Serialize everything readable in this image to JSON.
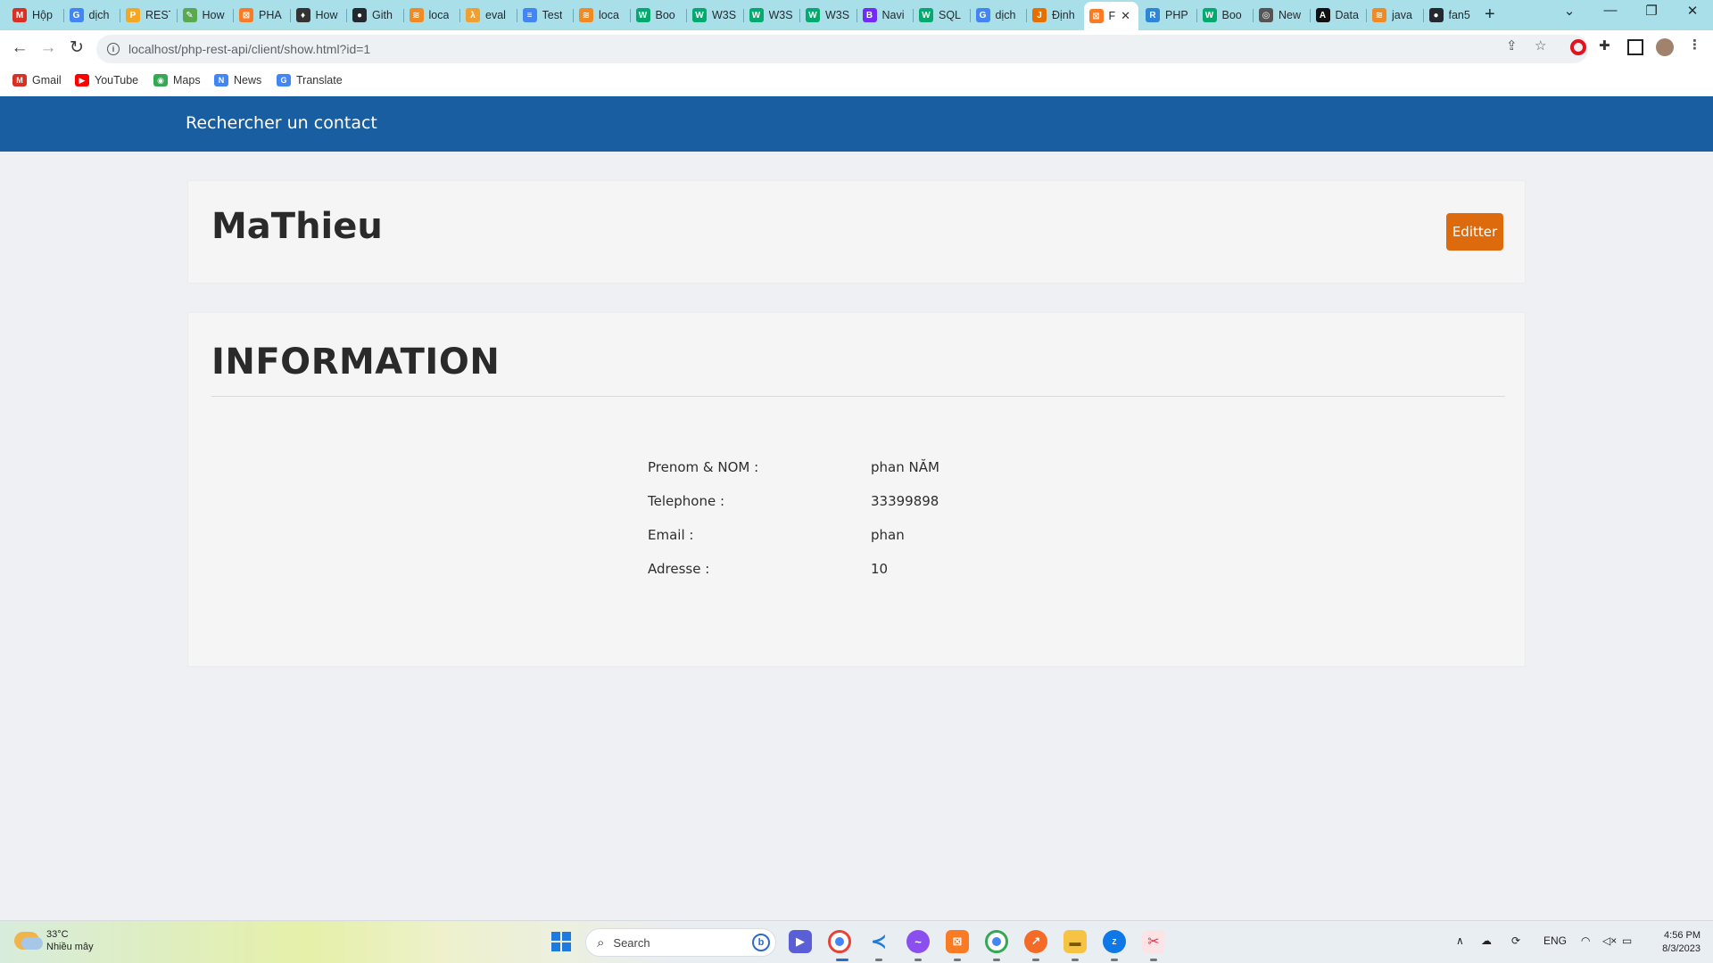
{
  "browser": {
    "tabs": [
      {
        "label": "Hộp",
        "icon": "gmail-icon",
        "color": "#d93025",
        "glyph": "M"
      },
      {
        "label": "dịch",
        "icon": "google-icon",
        "color": "#4285f4",
        "glyph": "G"
      },
      {
        "label": "REST",
        "icon": "postman-icon",
        "color": "#f5a623",
        "glyph": "P"
      },
      {
        "label": "How",
        "icon": "leaf-icon",
        "color": "#5aa84f",
        "glyph": "✎"
      },
      {
        "label": "PHA",
        "icon": "xampp-icon",
        "color": "#fb7a24",
        "glyph": "⊠"
      },
      {
        "label": "How",
        "icon": "mic-icon",
        "color": "#333333",
        "glyph": "♦"
      },
      {
        "label": "Gith",
        "icon": "github-icon",
        "color": "#24292f",
        "glyph": "●"
      },
      {
        "label": "loca",
        "icon": "localhost-icon",
        "color": "#f08a24",
        "glyph": "≋"
      },
      {
        "label": "eval",
        "icon": "eval-icon",
        "color": "#f0a030",
        "glyph": "λ"
      },
      {
        "label": "Test",
        "icon": "docs-icon",
        "color": "#4285f4",
        "glyph": "≡"
      },
      {
        "label": "loca",
        "icon": "localhost-icon",
        "color": "#f08a24",
        "glyph": "≋"
      },
      {
        "label": "Boo",
        "icon": "w3schools-icon",
        "color": "#04aa6d",
        "glyph": "W"
      },
      {
        "label": "W3S",
        "icon": "w3schools-icon",
        "color": "#04aa6d",
        "glyph": "W"
      },
      {
        "label": "W3S",
        "icon": "w3schools-icon",
        "color": "#04aa6d",
        "glyph": "W"
      },
      {
        "label": "W3S",
        "icon": "w3schools-icon",
        "color": "#04aa6d",
        "glyph": "W"
      },
      {
        "label": "Navi",
        "icon": "bootstrap-icon",
        "color": "#712cf9",
        "glyph": "B"
      },
      {
        "label": "SQL",
        "icon": "w3schools-icon",
        "color": "#04aa6d",
        "glyph": "W"
      },
      {
        "label": "dịch",
        "icon": "google-icon",
        "color": "#4285f4",
        "glyph": "G"
      },
      {
        "label": "Định",
        "icon": "java-icon",
        "color": "#e76f00",
        "glyph": "J"
      },
      {
        "label": "F",
        "icon": "xampp-icon",
        "color": "#fb7a24",
        "glyph": "⊠",
        "active": true
      },
      {
        "label": "PHP",
        "icon": "r-icon",
        "color": "#2f86d6",
        "glyph": "R"
      },
      {
        "label": "Boo",
        "icon": "w3schools-icon",
        "color": "#04aa6d",
        "glyph": "W"
      },
      {
        "label": "New",
        "icon": "chrome-icon",
        "color": "#555555",
        "glyph": "◎"
      },
      {
        "label": "Data",
        "icon": "data-icon",
        "color": "#111111",
        "glyph": "A"
      },
      {
        "label": "java",
        "icon": "localhost-icon",
        "color": "#f08a24",
        "glyph": "≋"
      },
      {
        "label": "fan5",
        "icon": "github-icon",
        "color": "#24292f",
        "glyph": "●"
      }
    ],
    "tab_close": "✕",
    "new_tab": "+",
    "url": "localhost/php-rest-api/client/show.html?id=1",
    "bookmarks": [
      {
        "label": "Gmail",
        "icon": "gmail-icon",
        "color": "#d93025",
        "glyph": "M"
      },
      {
        "label": "YouTube",
        "icon": "youtube-icon",
        "color": "#ff0000",
        "glyph": "▶"
      },
      {
        "label": "Maps",
        "icon": "maps-icon",
        "color": "#34a853",
        "glyph": "◉"
      },
      {
        "label": "News",
        "icon": "news-icon",
        "color": "#4285f4",
        "glyph": "N"
      },
      {
        "label": "Translate",
        "icon": "translate-icon",
        "color": "#4285f4",
        "glyph": "G"
      }
    ]
  },
  "page": {
    "nav_brand": "Rechercher un contact",
    "contact_name": "MaThieu",
    "edit_label": "Editter",
    "section_title": "INFORMATION",
    "fields": [
      {
        "label": "Prenom & NOM :",
        "value": "phan NĂM"
      },
      {
        "label": "Telephone :",
        "value": "33399898"
      },
      {
        "label": "Email :",
        "value": "phan"
      },
      {
        "label": "Adresse :",
        "value": "10"
      }
    ],
    "colors": {
      "navbar": "#185ea1",
      "edit_button": "#dd6b0d"
    }
  },
  "taskbar": {
    "weather_temp": "33°C",
    "weather_desc": "Nhiều mây",
    "search_placeholder": "Search",
    "language": "ENG",
    "time": "4:56 PM",
    "date": "8/3/2023"
  }
}
